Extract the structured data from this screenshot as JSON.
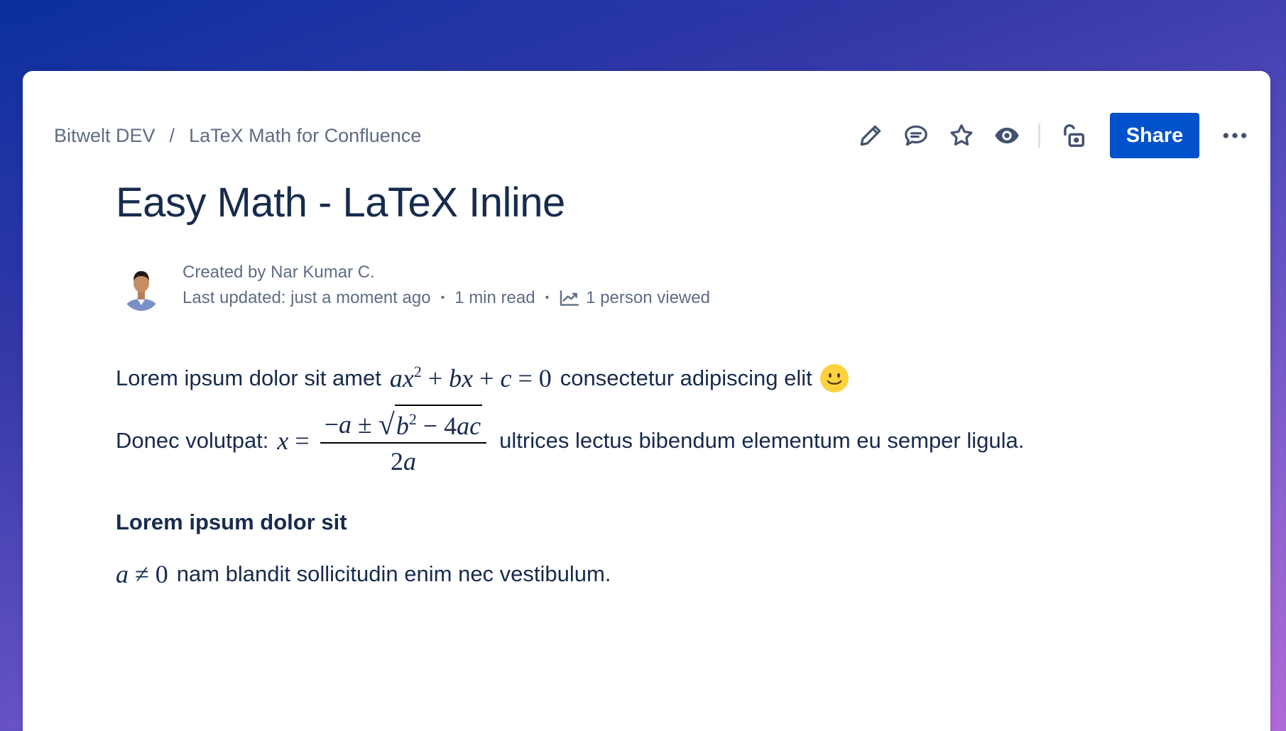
{
  "breadcrumb": {
    "space": "Bitwelt DEV",
    "separator": "/",
    "page": "LaTeX Math for Confluence"
  },
  "toolbar": {
    "edit_icon": "pencil-icon",
    "comment_icon": "comment-icon",
    "star_icon": "star-icon",
    "watch_icon": "eye-icon",
    "restrictions_icon": "unlock-icon",
    "share_label": "Share",
    "more_icon": "more-dots-icon",
    "accent": "#0052cc"
  },
  "page": {
    "title": "Easy Math - LaTeX Inline"
  },
  "byline": {
    "created_by": "Created by Nar Kumar C.",
    "last_updated": "Last updated: just a moment ago",
    "dot": "•",
    "read_time": "1 min read",
    "views": "1 person viewed"
  },
  "body": {
    "p1_before": "Lorem ipsum dolor sit amet",
    "p1_after": "consectetur adipiscing elit",
    "p2_before": "Donec volutpat:",
    "p2_after": "ultrices lectus bibendum elementum eu semper ligula.",
    "heading": "Lorem ipsum dolor sit",
    "p3_after": "nam blandit sollicitudin enim nec vestibulum."
  }
}
